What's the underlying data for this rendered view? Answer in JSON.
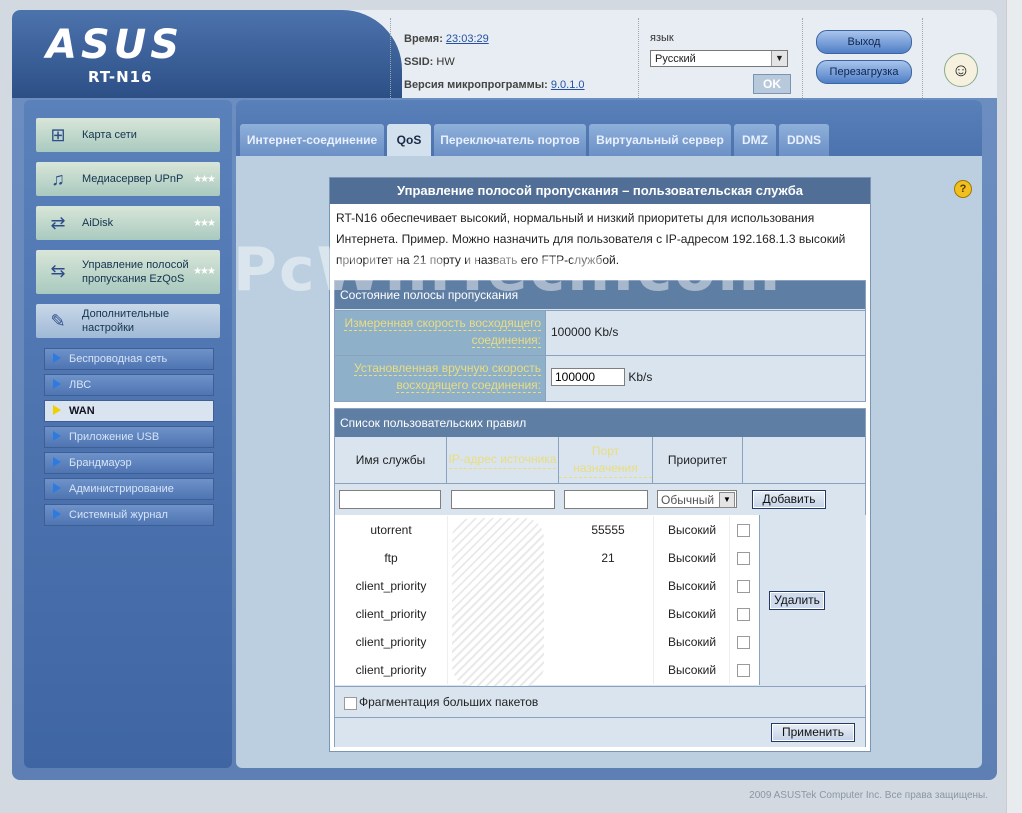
{
  "header": {
    "logo": "ASUS",
    "model": "RT-N16",
    "time_label": "Время:",
    "time_value": "23:03:29",
    "ssid_label": "SSID:",
    "ssid_value": "HW",
    "fw_label": "Версия микропрограммы:",
    "fw_value": "9.0.1.0",
    "lang_label": "язык",
    "lang_value": "Русский",
    "ok_label": "OK",
    "logout_label": "Выход",
    "reboot_label": "Перезагрузка"
  },
  "sidebar": {
    "main_items": [
      {
        "label": "Карта сети",
        "icon": "network-map-icon"
      },
      {
        "label": "Медиасервер UPnP",
        "icon": "media-server-icon"
      },
      {
        "label": "AiDisk",
        "icon": "aidisk-icon"
      },
      {
        "label": "Управление полосой пропускания EzQoS",
        "icon": "ezqos-icon"
      },
      {
        "label": "Дополнительные настройки",
        "icon": "advanced-settings-icon"
      }
    ],
    "sub_items": [
      {
        "label": "Беспроводная сеть"
      },
      {
        "label": "ЛВС"
      },
      {
        "label": "WAN"
      },
      {
        "label": "Приложение USB"
      },
      {
        "label": "Брандмауэр"
      },
      {
        "label": "Администрирование"
      },
      {
        "label": "Системный журнал"
      }
    ],
    "active_sub": "WAN"
  },
  "tabs": [
    {
      "label": "Интернет-соединение"
    },
    {
      "label": "QoS"
    },
    {
      "label": "Переключатель портов"
    },
    {
      "label": "Виртуальный сервер"
    },
    {
      "label": "DMZ"
    },
    {
      "label": "DDNS"
    }
  ],
  "active_tab": "QoS",
  "panel": {
    "title": "Управление полосой пропускания – пользовательская служба",
    "description": "RT-N16 обеспечивает высокий, нормальный и низкий приоритеты для использования Интернета. Пример. Можно назначить для пользователя с IP-адресом 192.168.1.3 высокий приоритет на 21 порту и назвать его FTP-службой.",
    "bandwidth": {
      "header": "Состояние полосы пропускания",
      "measured_label": "Измеренная скорость восходящего соединения:",
      "measured_value": "100000 Kb/s",
      "manual_label": "Установленная вручную скорость восходящего соединения:",
      "manual_value": "100000",
      "manual_unit": "Kb/s"
    },
    "rules": {
      "header": "Список пользовательских правил",
      "columns": [
        "Имя службы",
        "IP-адрес источника",
        "Порт назначения",
        "Приоритет"
      ],
      "priority_default": "Обычный",
      "add_label": "Добавить",
      "delete_label": "Удалить",
      "rows": [
        {
          "name": "utorrent",
          "ip": "",
          "port": "55555",
          "priority": "Высокий"
        },
        {
          "name": "ftp",
          "ip": "",
          "port": "21",
          "priority": "Высокий"
        },
        {
          "name": "client_priority",
          "ip": "",
          "port": "",
          "priority": "Высокий"
        },
        {
          "name": "client_priority",
          "ip": "",
          "port": "",
          "priority": "Высокий"
        },
        {
          "name": "client_priority",
          "ip": "",
          "port": "",
          "priority": "Высокий"
        },
        {
          "name": "client_priority",
          "ip": "",
          "port": "",
          "priority": "Высокий"
        }
      ],
      "fragment_label": "Фрагментация больших пакетов",
      "apply_label": "Применить"
    }
  },
  "footer": "2009 ASUSTek Computer Inc. Все права защищены.",
  "watermark": "PcWinTech.com"
}
